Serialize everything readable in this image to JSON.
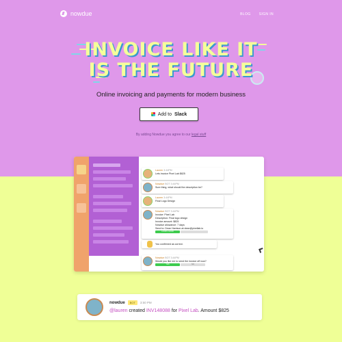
{
  "brand": {
    "name": "nowdue"
  },
  "nav": {
    "blog": "BLOG",
    "sign_in": "SIGN IN"
  },
  "hero": {
    "headline_line1": "INVOICE LIKE IT",
    "headline_line2": "IS THE FUTURE",
    "subtitle": "Online invoicing and payments for modern business",
    "cta_prefix": "Add to",
    "cta_brand": "Slack",
    "terms_prefix": "By adding Nowdue you agree to our",
    "terms_link": "legal stuff"
  },
  "colors": {
    "hero_bg": "#df98ea",
    "lower_bg": "#efff96",
    "headline": "#f5ff9a",
    "headline_shadow": "#3b98cf"
  },
  "chat": {
    "messages": [
      {
        "name": "Lauren",
        "time": "3:44PM",
        "text": "Lets invoice Pixel Lab $825"
      },
      {
        "name": "Nowdue",
        "badge": "BOT",
        "time": "3:44PM",
        "text": "Sure thing, what should the description be?"
      },
      {
        "name": "Lauren",
        "time": "3:44PM",
        "text": "Final Logo Design"
      },
      {
        "name": "Nowdue",
        "badge": "BOT",
        "time": "3:44PM",
        "lines": [
          "Invoice: Pixel Lab",
          "Description: Final logo design",
          "Invoice amount: $825",
          "Nowdue allowance: 7 days",
          "Send to: Dean Harrison at dean@pixellab.io"
        ],
        "action": "LOOKS GOOD"
      },
      {
        "text": "You confirmed as correct."
      },
      {
        "name": "Nowdue",
        "badge": "BOT",
        "time": "3:44PM",
        "text": "Would you like me to send the invoice off now?",
        "action_yes": "YES",
        "action_no": "NO"
      }
    ]
  },
  "feed": {
    "name": "nowdue",
    "badge": "BOT",
    "time": "3:50 PM",
    "mention": "@lauren",
    "verb": "created",
    "invoice_id": "INV148088",
    "prep": "for",
    "client": "Pixel Lab",
    "amount_text": ". Amount $825"
  }
}
